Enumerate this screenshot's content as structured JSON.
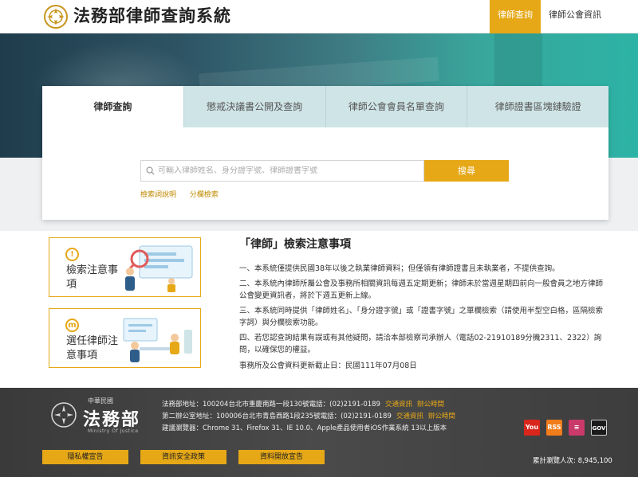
{
  "header": {
    "title": "法務部律師查詢系統",
    "nav": [
      "律師查詢",
      "律師公會資訊"
    ]
  },
  "search_card": {
    "tabs": [
      "律師查詢",
      "懲戒決議書公開及查詢",
      "律師公會會員名單查詢",
      "律師證書區塊鏈驗證"
    ],
    "active_tab": 0,
    "search_placeholder": "可輸入律師姓名、身分證字號、律師證書字號",
    "search_button": "搜尋",
    "links": [
      "檢索詞說明",
      "分欄檢索"
    ]
  },
  "side_cards": [
    {
      "icon": "exclamation-icon",
      "icon_text": "!",
      "label": "檢索注意事項"
    },
    {
      "icon": "document-icon",
      "icon_text": "m",
      "label": "選任律師注意事項"
    }
  ],
  "notes": {
    "title": "「律師」檢索注意事項",
    "items": [
      "一、本系統僅提供民國38年以後之執業律師資料；但僅領有律師證書且未執業者，不提供查詢。",
      "二、本系統內律師所屬公會及事務所相關資訊每週五定期更新；律師未於當週星期四前向一般會員之地方律師公會變更資訊者，將於下週五更新上線。",
      "三、本系統同時提供「律師姓名」、「身分證字號」或「證書字號」之單欄檢索（請使用半型空白格，區隔檢索字詞）與分欄檢索功能。",
      "四、若您認查詢結果有誤或有其他疑問，請洽本部檢察司承辦人（電話02-21910189分機2311、2322）詢問，以確保您的權益。"
    ],
    "update": "事務所及公會資料更新截止日：民國111年07月08日"
  },
  "footer": {
    "org_small": "中華民國",
    "org": "法務部",
    "org_en": "Ministry Of Justice",
    "line1": "法務部地址：100204台北市重慶南路一段130號電話：(02)2191-0189",
    "line1_links": [
      "交通資訊",
      "辦公時間"
    ],
    "line2": "第二辦公室地址：100006台北市青島西路1段235號電話：(02)2191-0189",
    "line2_links": [
      "交通資訊",
      "辦公時間"
    ],
    "line3": "建議瀏覽器：Chrome 31、Firefox 31、IE 10.0、Apple產品使用者iOS作業系統 13以上版本",
    "buttons": [
      "隱私權宣告",
      "資訊安全政策",
      "資料開放宣告"
    ],
    "visits": "累計瀏覽人次: 8,945,100",
    "social": [
      {
        "icon": "youtube-icon",
        "text": "You",
        "color": "#d9261c"
      },
      {
        "icon": "rss-icon",
        "text": "RSS",
        "color": "#f07c1b"
      },
      {
        "icon": "list-icon",
        "text": "≡",
        "color": "#c93a6b"
      },
      {
        "icon": "gov-icon",
        "text": "GOV",
        "color": "#1a1a1a"
      }
    ]
  }
}
